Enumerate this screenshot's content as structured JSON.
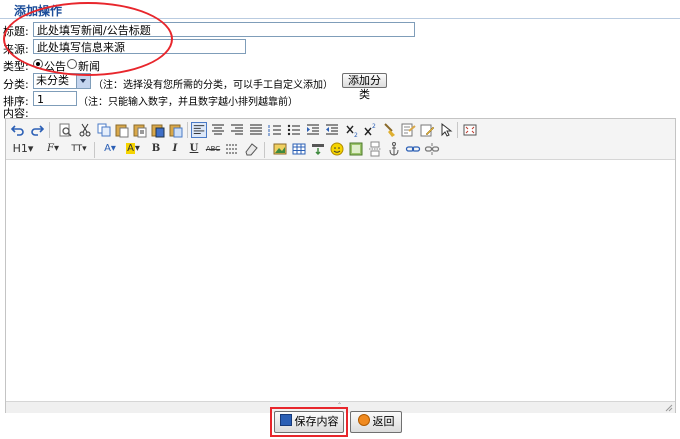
{
  "header": {
    "title": "添加操作"
  },
  "form": {
    "title_label": "标题:",
    "title_value": "此处填写新闻/公告标题",
    "source_label": "来源:",
    "source_value": "此处填写信息来源",
    "type_label": "类型:",
    "type_options": [
      "公告",
      "新闻"
    ],
    "type_selected": "公告",
    "category_label": "分类:",
    "category_value": "未分类",
    "category_note": "（注：选择没有您所需的分类，可以手工自定义添加）",
    "add_category_label": "添加分类",
    "order_label": "排序:",
    "order_value": "1",
    "order_note": "（注：只能输入数字，并且数字越小排列越靠前）",
    "content_label": "内容:"
  },
  "toolbar": {
    "row1": [
      "undo-icon",
      "redo-icon",
      "|",
      "preview-icon",
      "cut-icon",
      "copy-icon",
      "paste-icon",
      "paste-text-icon",
      "paste-word-icon",
      "|",
      "align-left-icon",
      "align-center-icon",
      "align-right-icon",
      "align-justify-icon",
      "ordered-list-icon",
      "unordered-list-icon",
      "indent-icon",
      "outdent-icon",
      "subscript-icon",
      "superscript-icon",
      "clear-format-icon",
      "select-all-icon",
      "pointer-icon",
      "|",
      "fullscreen-icon"
    ],
    "row2": [
      "heading",
      "font-family",
      "font-size",
      "|",
      "font-color",
      "highlight",
      "bold",
      "italic",
      "underline",
      "strikethrough",
      "line-height",
      "eraser",
      "|",
      "image-icon",
      "table-icon",
      "media-icon",
      "emoticon-icon",
      "flash-icon",
      "pagebreak-icon",
      "anchor-icon",
      "link-icon",
      "unlink-icon"
    ],
    "heading_label": "H1",
    "font_family_label": "F",
    "font_size_label": "TT"
  },
  "actions": {
    "save_label": "保存内容",
    "back_label": "返回"
  },
  "colors": {
    "accent": "#1d4e9a",
    "annotation_red": "#e8262c"
  }
}
